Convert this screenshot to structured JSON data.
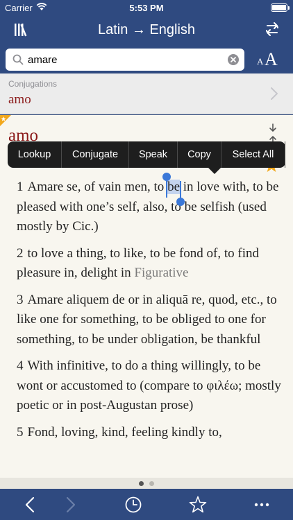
{
  "status_bar": {
    "carrier": "Carrier",
    "time": "5:53 PM",
    "battery_level": 1.0
  },
  "nav": {
    "title": "Latin → English",
    "left_icon": "library-icon",
    "right_icon": "swap-icon"
  },
  "search": {
    "value": "amare",
    "placeholder": "",
    "font_small": "A",
    "font_large": "A"
  },
  "suggestion": {
    "section_label": "Conjugations",
    "word": "amo"
  },
  "entry": {
    "headword": "amo",
    "definitions": [
      {
        "num": "1",
        "pre": "Amare se, of vain men, to ",
        "selected": "be",
        "post": " in love with, to be pleased with one’s self, also, to be selfish (used mostly by Cic.)",
        "tail": ""
      },
      {
        "num": "2",
        "pre": "to love a thing, to like, to be fond of, to find pleasure in, delight in ",
        "selected": "",
        "post": "",
        "tail": "Figurative"
      },
      {
        "num": "3",
        "pre": "Amare aliquem de or in aliquā re, quod, etc., to like one for something, to be obliged to one for something, to be under obligation, be thankful",
        "selected": "",
        "post": "",
        "tail": ""
      },
      {
        "num": "4",
        "pre": "With infinitive, to do a thing willingly, to be wont or accustomed to (compare to φιλέω; mostly poetic or in post-Augustan prose)",
        "selected": "",
        "post": "",
        "tail": ""
      },
      {
        "num": "5",
        "pre": "Fond, loving, kind, feeling kindly to,",
        "selected": "",
        "post": "",
        "tail": ""
      }
    ]
  },
  "context_menu": {
    "items": [
      "Lookup",
      "Conjugate",
      "Speak",
      "Copy",
      "Select All"
    ]
  },
  "pager": {
    "count": 2,
    "active": 0
  },
  "toolbar": {
    "items": [
      "back-icon",
      "forward-icon",
      "history-icon",
      "favorites-icon",
      "more-icon"
    ]
  },
  "colors": {
    "nav_bg": "#2f4a80",
    "headword": "#8b1a1a",
    "selection": "#c4d3ee",
    "handle": "#3b78d8",
    "star": "#f2a81d"
  }
}
